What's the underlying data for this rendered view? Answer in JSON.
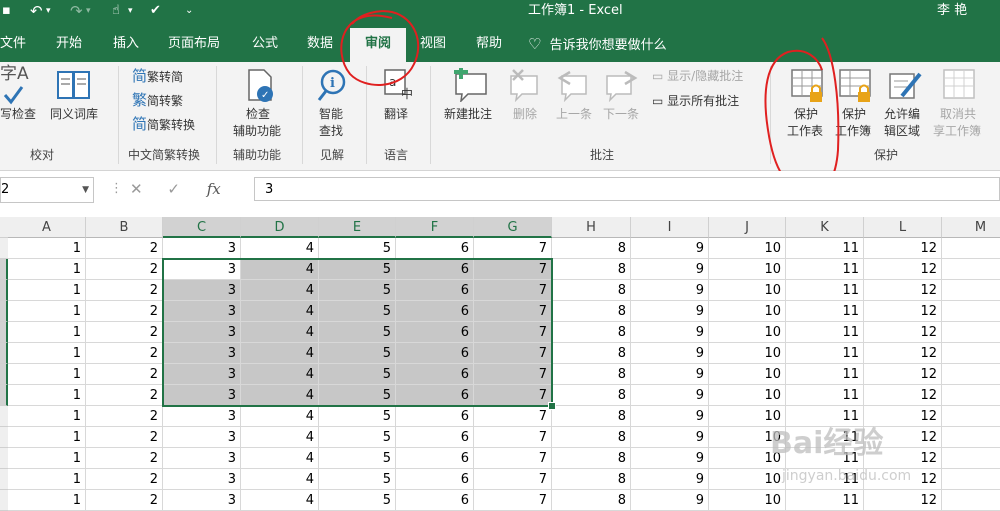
{
  "titlebar": {
    "title": "工作簿1  -  Excel",
    "user": "李 艳",
    "bg_color": "#217346"
  },
  "tabs": [
    "文件",
    "开始",
    "插入",
    "页面布局",
    "公式",
    "数据",
    "审阅",
    "视图",
    "帮助"
  ],
  "active_tab": "审阅",
  "tell_me": "告诉我你想要做什么",
  "ribbon": {
    "proofing": {
      "spellcheck": "写检查",
      "spellcheck_prefix": "字A",
      "thesaurus": "同义词库",
      "group": "校对"
    },
    "chinese": {
      "t2s": "繁转简",
      "s2t": "简转繁",
      "convert": "简繁转换",
      "group": "中文简繁转换"
    },
    "accessibility": {
      "check_l1": "检查",
      "check_l2": "辅助功能",
      "group": "辅助功能"
    },
    "insights": {
      "smart_l1": "智能",
      "smart_l2": "查找",
      "group": "见解"
    },
    "language": {
      "translate": "翻译",
      "group": "语言"
    },
    "comments": {
      "new": "新建批注",
      "delete": "删除",
      "prev": "上一条",
      "next": "下一条",
      "show_hide": "显示/隐藏批注",
      "show_all": "显示所有批注",
      "group": "批注"
    },
    "protect": {
      "sheet_l1": "保护",
      "sheet_l2": "工作表",
      "book_l1": "保护",
      "book_l2": "工作簿",
      "edit_l1": "允许编",
      "edit_l2": "辑区域",
      "unshare_l1": "取消共",
      "unshare_l2": "享工作簿",
      "group": "保护"
    }
  },
  "formula_bar": {
    "name_box": "2",
    "fx": "fx",
    "value": "3"
  },
  "sheet": {
    "columns": [
      "A",
      "B",
      "C",
      "D",
      "E",
      "F",
      "G",
      "H",
      "I",
      "J",
      "K",
      "L",
      "M"
    ],
    "row_values": [
      1,
      2,
      3,
      4,
      5,
      6,
      7,
      8,
      9,
      10,
      11,
      12
    ],
    "row_count": 13
  },
  "watermark": {
    "brand": "Bai经验",
    "url": "jingyan.baidu.com"
  }
}
